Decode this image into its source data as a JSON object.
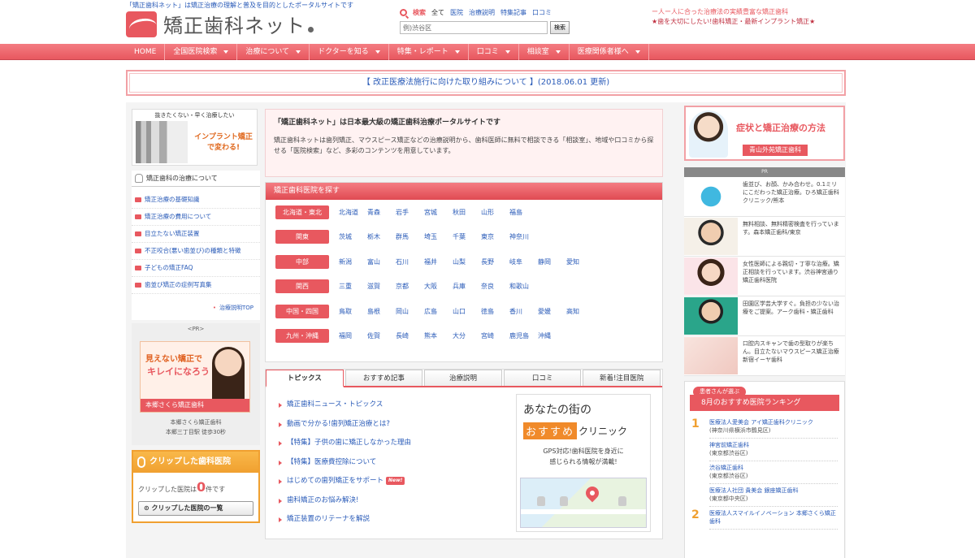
{
  "header": {
    "tagline": "「矯正歯科ネット」は矯正治療の理解と普及を目的としたポータルサイトです",
    "logo_text": "矯正歯科ネット",
    "search": {
      "label": "検索",
      "options": [
        "全て",
        "医院",
        "治療説明",
        "特集記事",
        "口コミ"
      ],
      "input_value": "例)渋谷区",
      "button": "検索"
    },
    "links": [
      "ー人ー人に合った治療法の実績豊富な矯正歯科",
      "★歯を大切にしたい!歯科矯正・最新インプラント矯正★"
    ]
  },
  "nav": {
    "items": [
      {
        "label": "HOME",
        "dropdown": false
      },
      {
        "label": "全国医院検索",
        "dropdown": true
      },
      {
        "label": "治療について",
        "dropdown": true
      },
      {
        "label": "ドクターを知る",
        "dropdown": true
      },
      {
        "label": "特集・レポート",
        "dropdown": true
      },
      {
        "label": "口コミ",
        "dropdown": true
      },
      {
        "label": "相談室",
        "dropdown": true
      },
      {
        "label": "医療関係者様へ",
        "dropdown": true
      }
    ]
  },
  "notice": "【 改正医療法施行に向けた取り組みについて 】(2018.06.01 更新)",
  "left": {
    "banner1_caption": "抜きたくない・早く治療したい",
    "banner1_text": "インプラント矯正で変わる!",
    "section_title": "矯正歯科の治療について",
    "menu": [
      "矯正治療の基礎知識",
      "矯正治療の費用について",
      "目立たない矯正装置",
      "不正咬合(悪い歯並び)の種類と特徴",
      "子どもの矯正FAQ",
      "歯並び矯正の症例写真集"
    ],
    "more": "治療説明TOP",
    "pr_label": "<PR>",
    "pr_ad": {
      "line1": "見えない矯正で",
      "line2": "キレイになろう",
      "bar": "本郷さくら矯正歯科"
    },
    "pr_caption": [
      "本郷さくら矯正歯科",
      "本郷三丁目駅 徒歩30秒"
    ],
    "clip": {
      "title": "クリップした歯科医院",
      "count_prefix": "クリップした医院は",
      "count": "0",
      "count_suffix": "件です",
      "list_button": "クリップした医院の一覧"
    }
  },
  "center": {
    "intro_title": "「矯正歯科ネット」は日本最大級の矯正歯科治療ポータルサイトです",
    "intro_text": "矯正歯科ネットは歯列矯正、マウスピース矯正などの治療説明から、歯科医師に無料で相談できる「相談室」、地域や口コミから探せる「医院検索」など、多彩のコンテンツを用意しています。",
    "search_title": "矯正歯科医院を探す",
    "regions": [
      {
        "name": "北海道・東北",
        "prefs": [
          "北海道",
          "青森",
          "岩手",
          "宮城",
          "秋田",
          "山形",
          "福島"
        ]
      },
      {
        "name": "関東",
        "prefs": [
          "茨城",
          "栃木",
          "群馬",
          "埼玉",
          "千葉",
          "東京",
          "神奈川"
        ]
      },
      {
        "name": "中部",
        "prefs": [
          "新潟",
          "富山",
          "石川",
          "福井",
          "山梨",
          "長野",
          "岐阜",
          "静岡",
          "愛知"
        ]
      },
      {
        "name": "関西",
        "prefs": [
          "三重",
          "滋賀",
          "京都",
          "大阪",
          "兵庫",
          "奈良",
          "和歌山"
        ]
      },
      {
        "name": "中国・四国",
        "prefs": [
          "鳥取",
          "島根",
          "岡山",
          "広島",
          "山口",
          "徳島",
          "香川",
          "愛媛",
          "高知"
        ]
      },
      {
        "name": "九州・沖縄",
        "prefs": [
          "福岡",
          "佐賀",
          "長崎",
          "熊本",
          "大分",
          "宮崎",
          "鹿児島",
          "沖縄"
        ]
      }
    ],
    "tabs": [
      "トピックス",
      "おすすめ記事",
      "治療説明",
      "口コミ",
      "新着!注目医院"
    ],
    "topics": [
      {
        "text": "矯正歯科ニュース・トピックス",
        "new": false
      },
      {
        "text": "動画で分かる!歯列矯正治療とは?",
        "new": false
      },
      {
        "text": "【特集】子供の歯に矯正しなかった理由",
        "new": false
      },
      {
        "text": "【特集】医療費控除について",
        "new": false
      },
      {
        "text": "はじめての歯列矯正をサポート",
        "new": true
      },
      {
        "text": "歯科矯正のお悩み解決!",
        "new": false
      },
      {
        "text": "矯正装置のリテーナを解説",
        "new": false
      }
    ],
    "new_badge": "New!",
    "map_ad": {
      "title": "あなたの街の",
      "osusume": "おすすめ",
      "clinic": "クリニック",
      "desc": [
        "GPS対応!歯科医院を身近に",
        "感じられる情報が満載!"
      ]
    }
  },
  "right": {
    "banner_title": "症状と矯正治療の方法",
    "banner_clinic": "青山外苑矯正歯科",
    "pr_label": "PR",
    "ads": [
      {
        "text": "歯並び、お顔、かみ合わせ。0.1ミリにこだわった矯正治療。ひろ矯正歯科クリニック/熊本",
        "thumb": "logo"
      },
      {
        "text": "無料相談、無料精密検査を行っています。森本矯正歯科/東京",
        "thumb": "doctor"
      },
      {
        "text": "女性医師による親切・丁寧な治療。矯正相談を行っています。渋谷神宮通り矯正歯科医院",
        "thumb": "woman"
      },
      {
        "text": "田園区学芸大学すぐ。負担の少ない治療をご提案。アーク歯科・矯正歯科",
        "thumb": "doctor2"
      },
      {
        "text": "口腔内スキャンで歯の型取りが楽ちん。目立たないマウスピース矯正治療 新宿イーヤ歯科",
        "thumb": "teeth"
      }
    ],
    "ranking": {
      "pill": "患者さんが選ぶ",
      "title": "8月のおすすめ医院ランキング",
      "entries": [
        {
          "rank": "1",
          "items": [
            {
              "name": "医療法人愛美会 アイ矯正歯科クリニック",
              "loc": "(神奈川県横浜市鶴見区)"
            },
            {
              "name": "神宮前矯正歯科",
              "loc": "(東京都渋谷区)"
            },
            {
              "name": "渋谷矯正歯科",
              "loc": "(東京都渋谷区)"
            },
            {
              "name": "医療法人社団 貴美会 銀座矯正歯科",
              "loc": "(東京都中央区)"
            }
          ]
        },
        {
          "rank": "2",
          "items": [
            {
              "name": "医療法人スマイルイノベーション 本郷さくら矯正歯科",
              "loc": ""
            }
          ]
        }
      ]
    }
  }
}
